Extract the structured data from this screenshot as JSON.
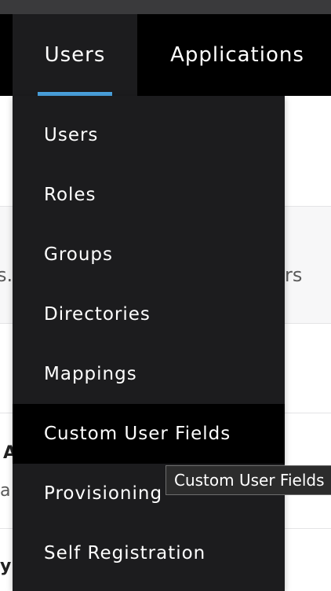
{
  "nav": {
    "tabs": [
      {
        "label": "Users",
        "active": true
      },
      {
        "label": "Applications",
        "active": false
      }
    ]
  },
  "background": {
    "fragment_left": "s..",
    "fragment_right": "rs",
    "fragment_a": "A",
    "fragment_a_lower": "a",
    "fragment_y": "y"
  },
  "menu": {
    "items": [
      {
        "label": "Users"
      },
      {
        "label": "Roles"
      },
      {
        "label": "Groups"
      },
      {
        "label": "Directories"
      },
      {
        "label": "Mappings"
      },
      {
        "label": "Custom User Fields",
        "hovered": true
      },
      {
        "label": "Provisioning"
      },
      {
        "label": "Self Registration"
      }
    ]
  },
  "tooltip": {
    "text": "Custom User Fields"
  },
  "colors": {
    "accent": "#4aa3df",
    "nav_bg": "#000000",
    "menu_bg": "#1c1c1e"
  }
}
